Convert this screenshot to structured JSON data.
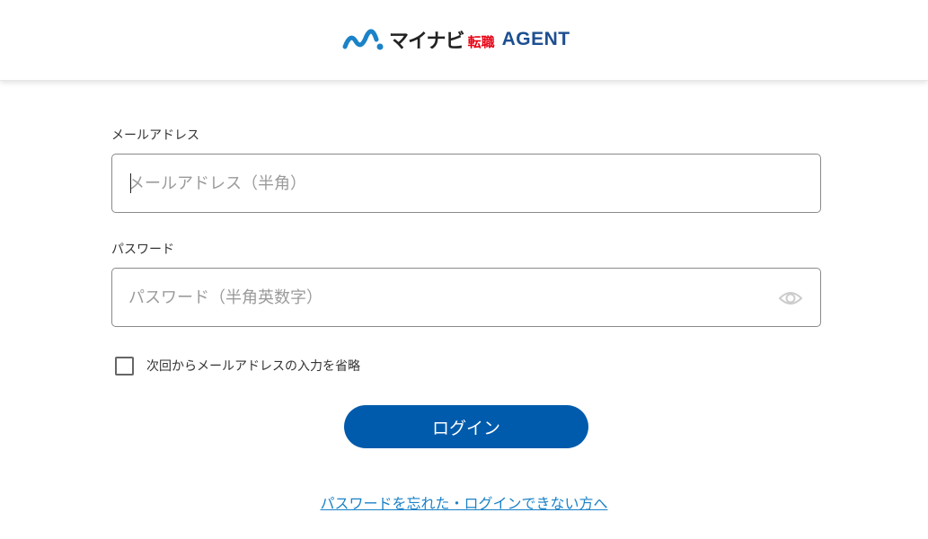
{
  "header": {
    "logo": {
      "main": "マイナビ",
      "red": "転職",
      "agent": "AGENT",
      "colors": {
        "mark": "#1b82c8",
        "red": "#e60012",
        "agent": "#1d4f91"
      }
    }
  },
  "email": {
    "label": "メールアドレス",
    "placeholder": "メールアドレス（半角）",
    "value": ""
  },
  "password": {
    "label": "パスワード",
    "placeholder": "パスワード（半角英数字）",
    "value": "",
    "toggle_icon": "eye-icon"
  },
  "remember": {
    "label": "次回からメールアドレスの入力を省略",
    "checked": false
  },
  "login_button": {
    "label": "ログイン",
    "color": "#005bac"
  },
  "forgot_link": {
    "label": "パスワードを忘れた・ログインできない方へ",
    "color": "#1b82c8"
  }
}
